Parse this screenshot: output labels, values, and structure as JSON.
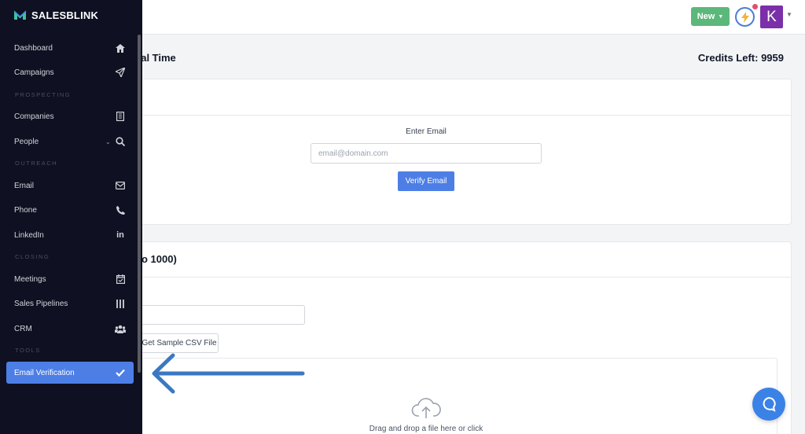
{
  "app": {
    "brand": "SALESBLINK"
  },
  "topbar": {
    "new_label": "New",
    "avatar_letter": "K"
  },
  "main": {
    "page_heading": "eal Time",
    "credits": "Credits Left: 9959",
    "single": {
      "label": "Enter Email",
      "placeholder": "email@domain.com",
      "button": "Verify Email"
    },
    "bulk": {
      "title": "o 1000)",
      "sample_button": "Get Sample CSV File",
      "drop_text": "Drag and drop a file here or click"
    }
  },
  "sidebar": {
    "items": [
      {
        "label": "Dashboard",
        "icon": "home-icon"
      },
      {
        "label": "Campaigns",
        "icon": "paper-plane-icon"
      },
      {
        "label": "Companies",
        "icon": "building-icon"
      },
      {
        "label": "People",
        "icon": "search-icon"
      },
      {
        "label": "Email",
        "icon": "envelope-icon"
      },
      {
        "label": "Phone",
        "icon": "phone-icon"
      },
      {
        "label": "LinkedIn",
        "icon": "linkedin-icon"
      },
      {
        "label": "Meetings",
        "icon": "calendar-check-icon"
      },
      {
        "label": "Sales Pipelines",
        "icon": "columns-icon"
      },
      {
        "label": "CRM",
        "icon": "users-icon"
      },
      {
        "label": "Email Verification",
        "icon": "check-icon"
      }
    ],
    "sections": [
      "PROSPECTING",
      "OUTREACH",
      "CLOSING",
      "TOOLS"
    ]
  },
  "colors": {
    "sidebar_bg": "#0f1021",
    "accent": "#4c7ee6",
    "new_button": "#5cb87a",
    "avatar": "#7b2fa8",
    "annotation_arrow": "#3a78c2"
  }
}
